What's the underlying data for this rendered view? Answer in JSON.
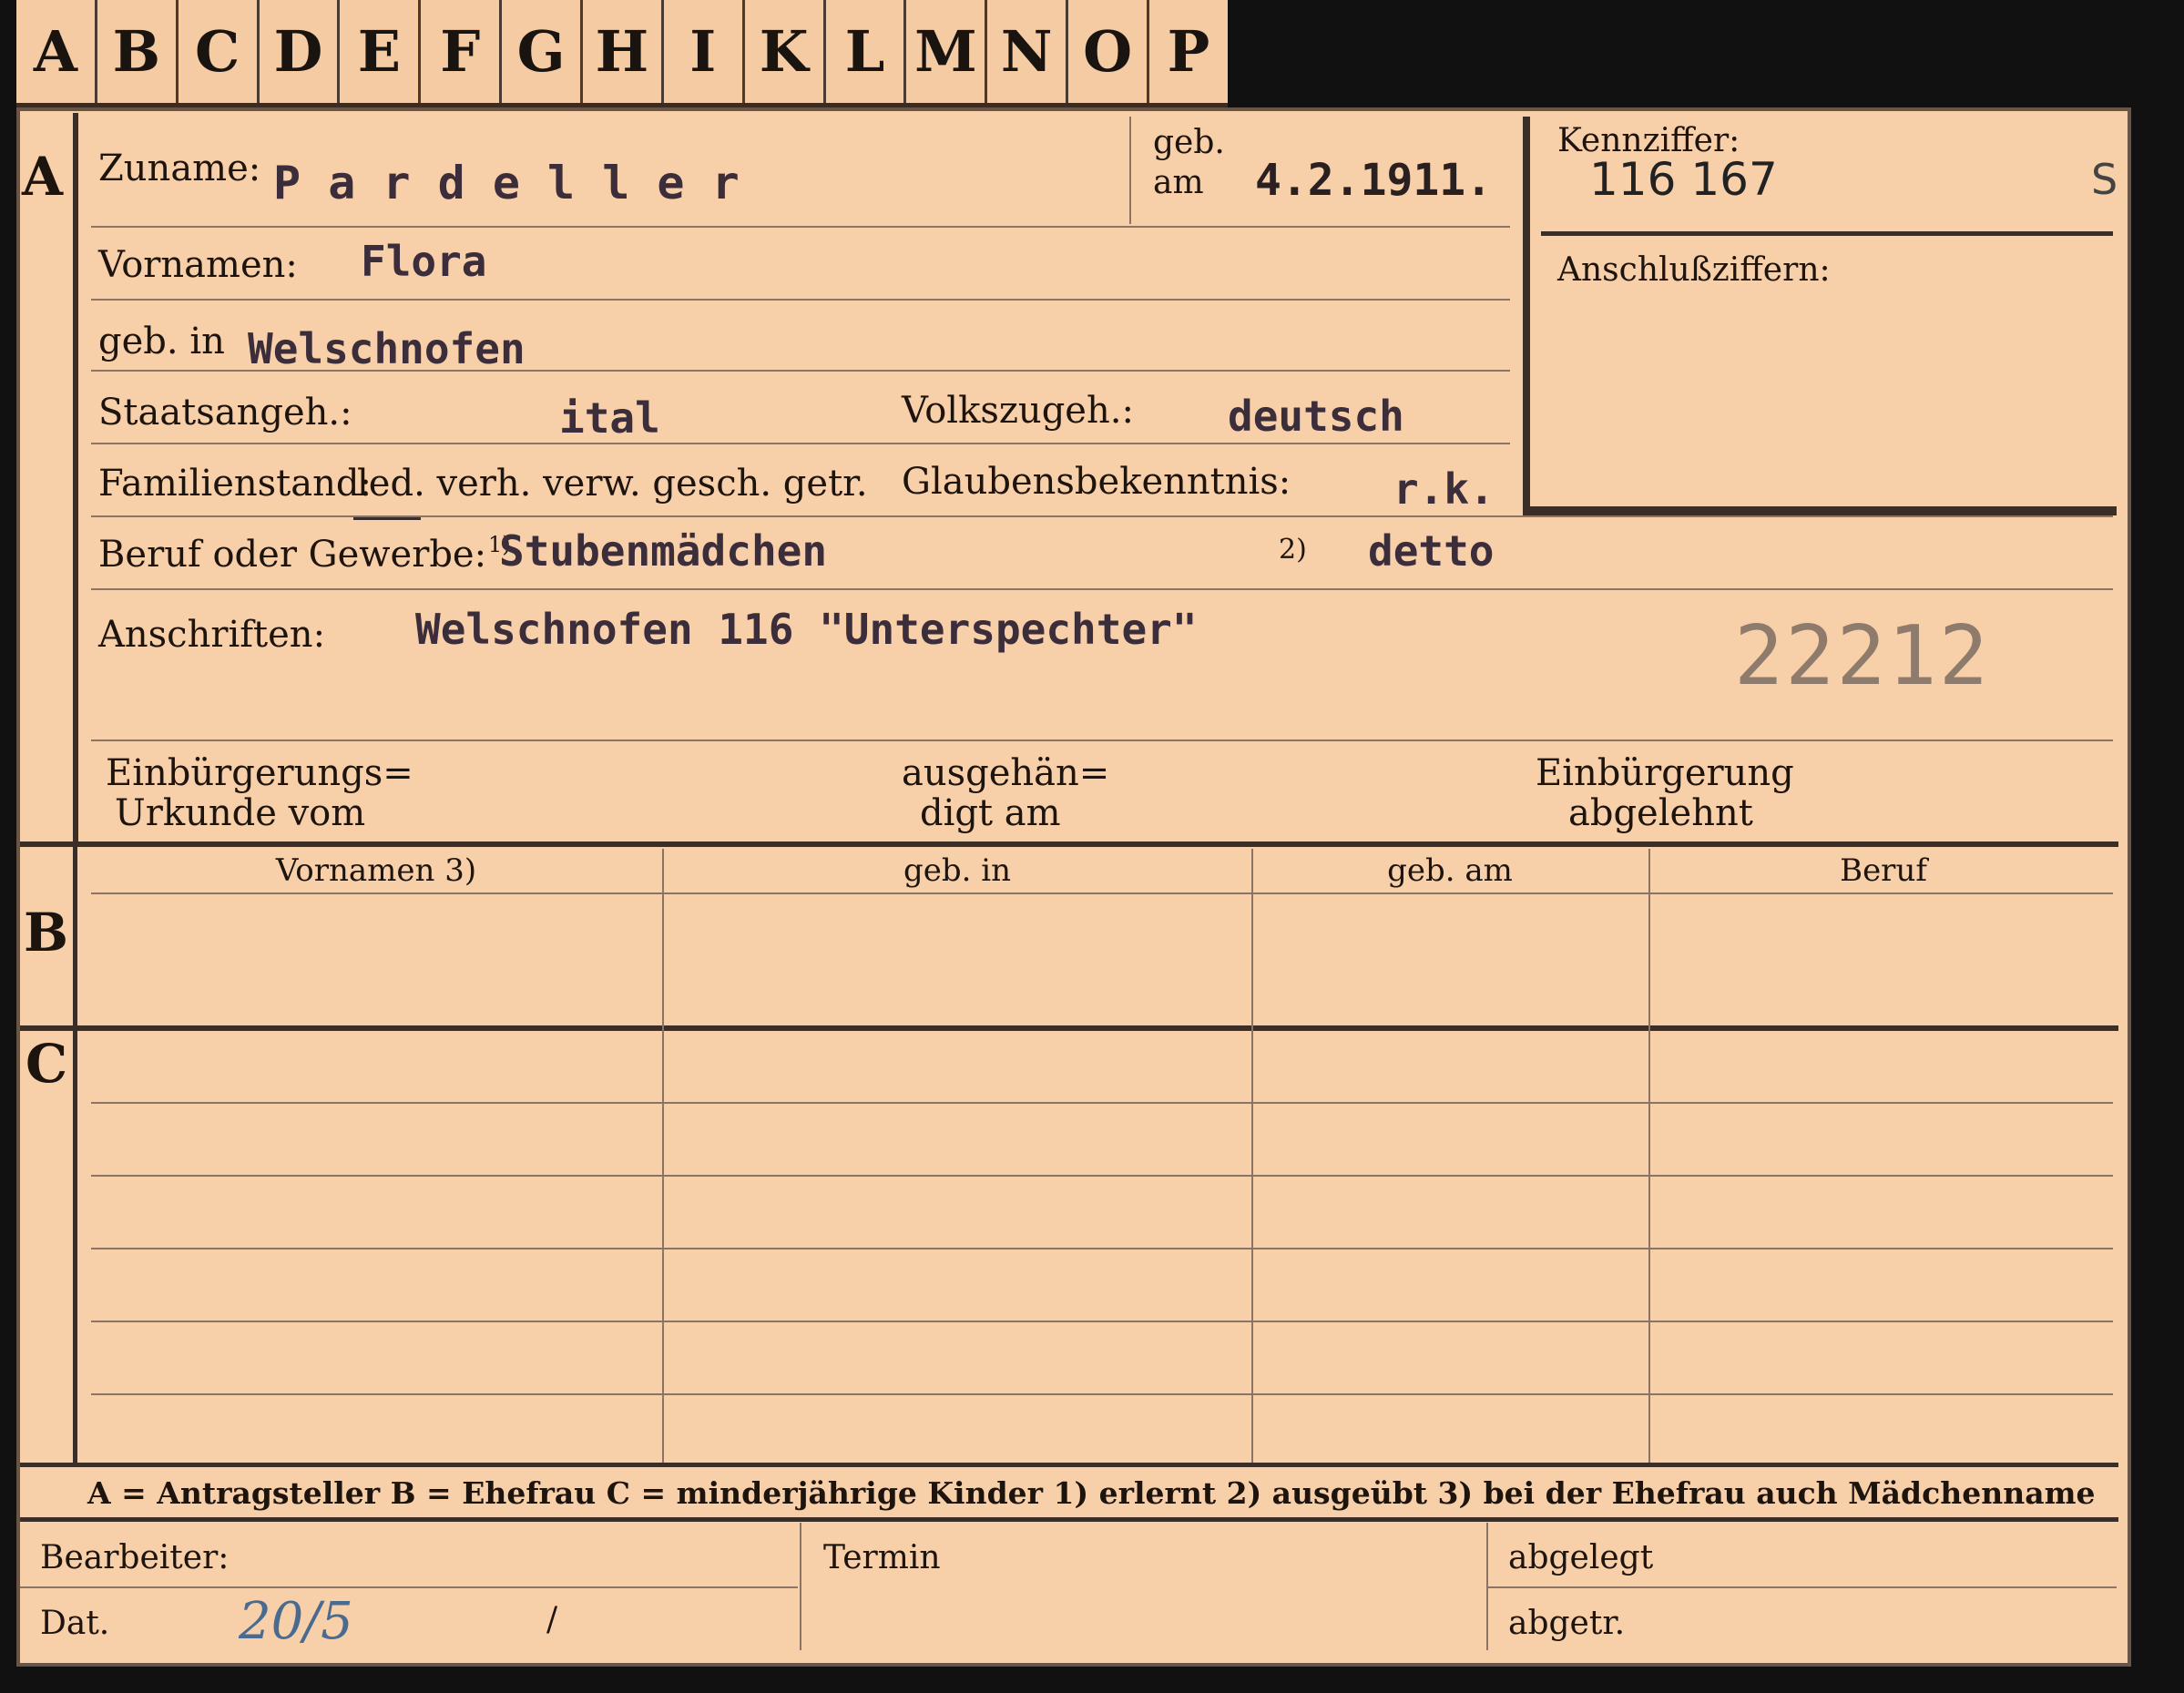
{
  "tabs": [
    "A",
    "B",
    "C",
    "D",
    "E",
    "F",
    "G",
    "H",
    "I",
    "K",
    "L",
    "M",
    "N",
    "O",
    "P"
  ],
  "sections": {
    "a": "A",
    "b": "B",
    "c": "C"
  },
  "labels": {
    "zuname": "Zuname:",
    "geb": "geb.",
    "am": "am",
    "vornamen": "Vornamen:",
    "geb_in": "geb. in",
    "staatsangeh": "Staatsangeh.:",
    "volkszugeh": "Volkszugeh.:",
    "familienstand": "Familienstand:",
    "familienstand_options": "led. verh. verw. gesch. getr.",
    "glaubensbekenntnis": "Glaubensbekenntnis:",
    "beruf": "Beruf oder Gewerbe:",
    "beruf_note1": "1)",
    "beruf_note2": "2)",
    "anschriften": "Anschriften:",
    "kennziffer": "Kennziffer:",
    "anschlussziffern": "Anschlußziffern:",
    "einbuergerungs_line1": "Einbürgerungs=",
    "einbuergerungs_line2": "Urkunde vom",
    "ausgehaen_line1": "ausgehän=",
    "ausgehaen_line2": "digt am",
    "einbuergerung_line1": "Einbürgerung",
    "einbuergerung_line2": "abgelehnt"
  },
  "values": {
    "zuname": "P a r d e l l e r",
    "geb_am": "4.2.1911.",
    "kennziffer": "116 167",
    "kennziffer_suffix": "S",
    "vornamen": "Flora",
    "geb_in": "Welschnofen",
    "staatsangeh": "ital",
    "volkszugeh": "deutsch",
    "glaubensbekenntnis": "r.k.",
    "beruf": "Stubenmädchen",
    "beruf_2": "detto",
    "anschrift": "Welschnofen 116 \"Unterspechter\"",
    "stamp_number": "22212"
  },
  "table_b": {
    "headers": [
      "Vornamen 3)",
      "geb. in",
      "geb. am",
      "Beruf"
    ]
  },
  "legend": "A = Antragsteller   B = Ehefrau   C = minderjährige Kinder   1) erlernt   2) ausgeübt   3) bei der Ehefrau auch Mädchenname",
  "footer": {
    "bearbeiter": "Bearbeiter:",
    "dat": "Dat.",
    "dat_value": "20/5",
    "dat_slash": "/",
    "termin": "Termin",
    "abgelegt": "abgelegt",
    "abgetr": "abgetr."
  }
}
